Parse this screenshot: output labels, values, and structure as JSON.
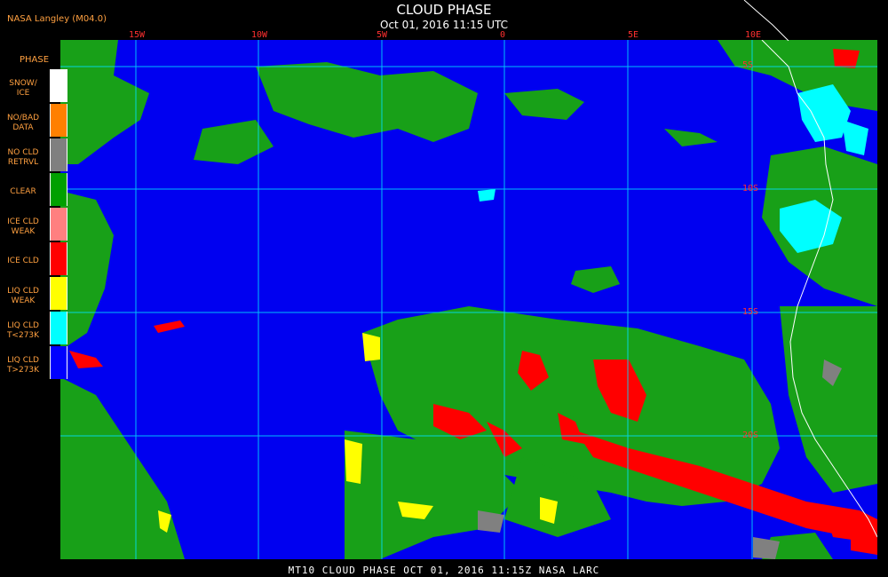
{
  "header": {
    "credit": "NASA Langley (M04.0)",
    "title": "CLOUD PHASE",
    "timestamp": "Oct 01, 2016 11:15 UTC"
  },
  "longitude_labels": [
    "15W",
    "10W",
    "5W",
    "0",
    "5E",
    "10E"
  ],
  "latitude_labels": [
    "5S",
    "10S",
    "15S",
    "20S"
  ],
  "legend": {
    "title": "PHASE",
    "items": [
      {
        "label_l1": "SNOW/",
        "label_l2": "ICE",
        "color": "#ffffff"
      },
      {
        "label_l1": "NO/BAD",
        "label_l2": "DATA",
        "color": "#ff8000"
      },
      {
        "label_l1": "NO CLD",
        "label_l2": "RETRVL",
        "color": "#808080"
      },
      {
        "label_l1": "CLEAR",
        "label_l2": "",
        "color": "#00a000"
      },
      {
        "label_l1": "ICE CLD",
        "label_l2": "WEAK",
        "color": "#ff8080"
      },
      {
        "label_l1": "ICE CLD",
        "label_l2": "",
        "color": "#ff0000"
      },
      {
        "label_l1": "LIQ CLD",
        "label_l2": "WEAK",
        "color": "#ffff00"
      },
      {
        "label_l1": "LIQ CLD",
        "label_l2": "T<273K",
        "color": "#00ffff"
      },
      {
        "label_l1": "LIQ CLD",
        "label_l2": "T>273K",
        "color": "#0000ff"
      }
    ]
  },
  "colors": {
    "ocean_liquid_cloud": "#0000f0",
    "clear": "#18a018",
    "ice": "#ff0000",
    "liq_cold": "#00ffff",
    "liq_weak": "#ffff00",
    "no_retrieval": "#808080",
    "grid": "#00e0ff",
    "coast": "#ffffff",
    "label_accent": "#ffa040"
  },
  "footer": "MT10  CLOUD PHASE  OCT 01, 2016 11:15Z  NASA LARC"
}
